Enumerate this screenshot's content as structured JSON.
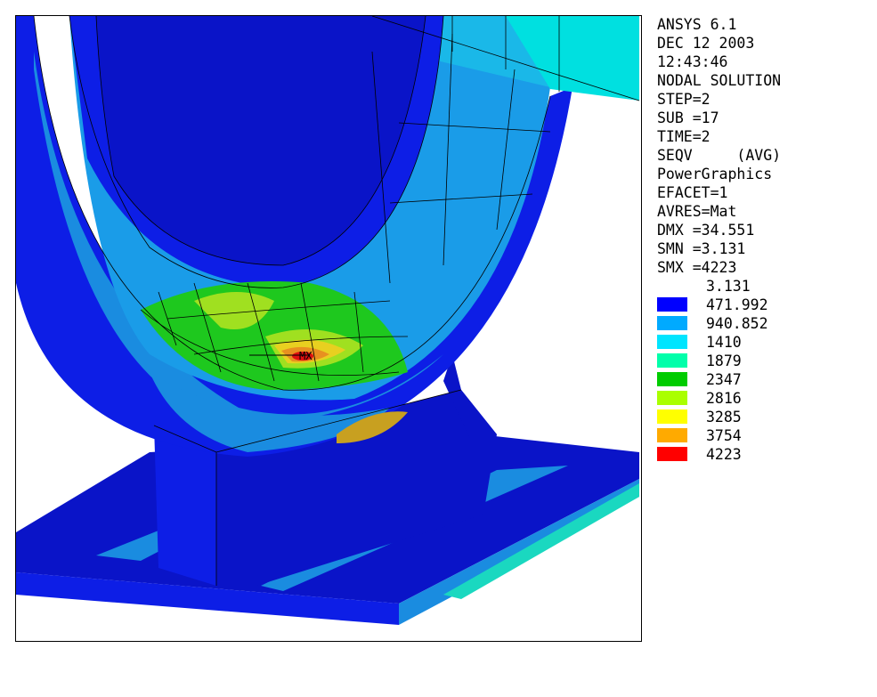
{
  "header_lines": [
    "ANSYS 6.1",
    "DEC 12 2003",
    "12:43:46",
    "NODAL SOLUTION",
    "STEP=2",
    "SUB =17",
    "TIME=2",
    "SEQV     (AVG)",
    "PowerGraphics",
    "EFACET=1",
    "AVRES=Mat",
    "DMX =34.551",
    "SMN =3.131",
    "SMX =4223"
  ],
  "legend": {
    "min_label": "3.131",
    "bands": [
      {
        "value": "471.992",
        "color": "#0000ff"
      },
      {
        "value": "940.852",
        "color": "#00aaff"
      },
      {
        "value": "1410",
        "color": "#00e5ff"
      },
      {
        "value": "1879",
        "color": "#00ffaa"
      },
      {
        "value": "2347",
        "color": "#00cc00"
      },
      {
        "value": "2816",
        "color": "#aaff00"
      },
      {
        "value": "3285",
        "color": "#ffff00"
      },
      {
        "value": "3754",
        "color": "#ffaa00"
      },
      {
        "value": "4223",
        "color": "#ff0000"
      }
    ]
  },
  "plot": {
    "max_marker_label": "MX"
  }
}
